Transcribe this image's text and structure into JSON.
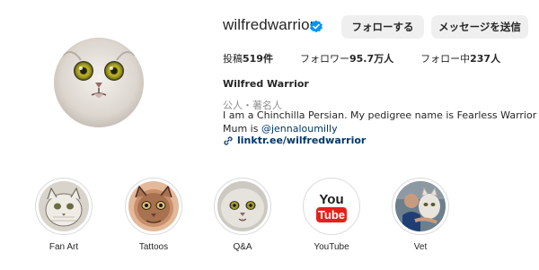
{
  "profile": {
    "username": "wilfredwarrior",
    "verified": true,
    "follow_label": "フォローする",
    "message_label": "メッセージを送信",
    "stats": {
      "posts_label": "投稿",
      "posts_count": "519件",
      "followers_label": "フォロワー",
      "followers_count": "95.7万人",
      "following_label": "フォロー中",
      "following_count": "237人"
    },
    "full_name": "Wilfred Warrior",
    "category": "公人・著名人",
    "bio_line1": "I am a Chinchilla Persian. My pedigree name is Fearless Warrior but my mum",
    "bio_line2_prefix": "Mum is ",
    "bio_mention": "@jennaloumilly",
    "link": "linktr.ee/wilfredwarrior"
  },
  "highlights": [
    {
      "label": "Fan Art",
      "icon": "fan-art-cat-drawing"
    },
    {
      "label": "Tattoos",
      "icon": "tattoo-cat-portrait"
    },
    {
      "label": "Q&A",
      "icon": "cat-face-photo"
    },
    {
      "label": "YouTube",
      "icon": "youtube-logo",
      "logo_top": "You",
      "logo_bottom": "Tube"
    },
    {
      "label": "Vet",
      "icon": "vet-visit-photo"
    }
  ],
  "colors": {
    "verified_badge": "#0095f6",
    "button_bg": "#efefef",
    "link_color": "#00376b",
    "muted_text": "#8e8e8e",
    "youtube_red": "#e62117"
  }
}
